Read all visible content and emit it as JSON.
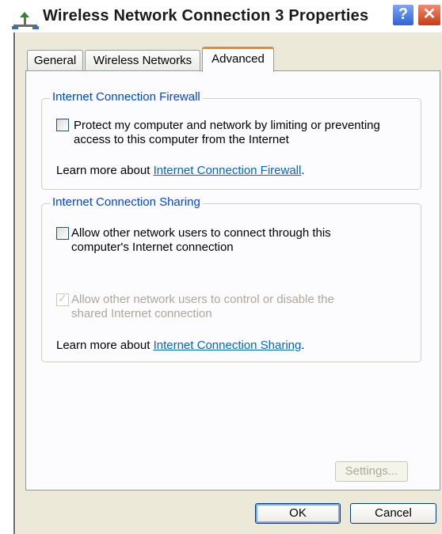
{
  "window": {
    "title": "Wireless Network Connection 3 Properties",
    "help_label": "?",
    "close_label": "✕"
  },
  "tabs": [
    {
      "label": "General"
    },
    {
      "label": "Wireless Networks"
    },
    {
      "label": "Advanced"
    }
  ],
  "firewall": {
    "legend": "Internet Connection Firewall",
    "checkbox_label_line1": "Protect my computer and network by limiting or preventing",
    "checkbox_label_line2": "access to this computer from the Internet",
    "learn_prefix": "Learn more about ",
    "learn_link": "Internet Connection Firewall",
    "learn_suffix": "."
  },
  "sharing": {
    "legend": "Internet Connection Sharing",
    "allow_connect_line1": "Allow other network users to connect through this",
    "allow_connect_line2": "computer's Internet connection",
    "allow_control_line1": "Allow other network users to control or disable the",
    "allow_control_line2": "shared Internet connection",
    "learn_prefix": "Learn more about ",
    "learn_link": "Internet Connection Sharing",
    "learn_suffix": "."
  },
  "buttons": {
    "settings": "Settings...",
    "ok": "OK",
    "cancel": "Cancel"
  },
  "colors": {
    "legend_blue": "#0046d5",
    "link_blue": "#0066cc",
    "active_tab_accent": "#e68b2c",
    "dialog_bg": "#ece9d8"
  }
}
